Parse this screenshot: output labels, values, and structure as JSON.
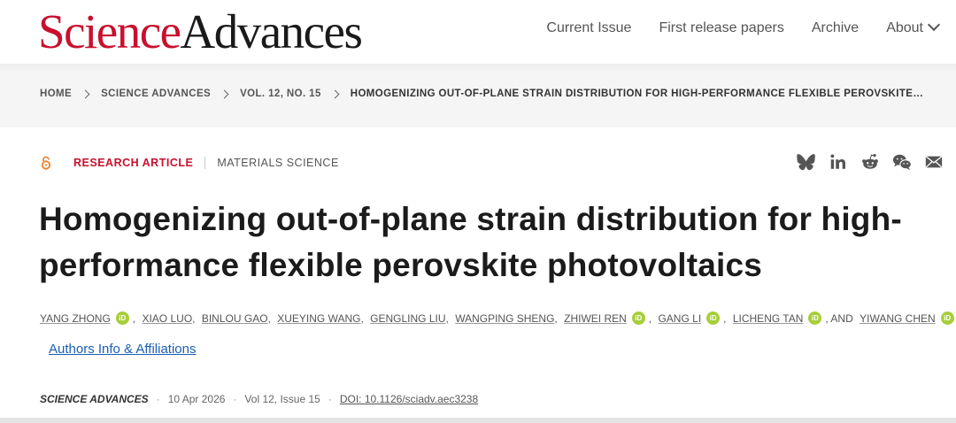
{
  "header": {
    "logo_science": "Science",
    "logo_advances": "Advances",
    "nav": [
      "Current Issue",
      "First release papers",
      "Archive",
      "About"
    ]
  },
  "breadcrumb": [
    "HOME",
    "SCIENCE ADVANCES",
    "VOL. 12, NO. 15",
    "HOMOGENIZING OUT-OF-PLANE STRAIN DISTRIBUTION FOR HIGH-PERFORMANCE FLEXIBLE PEROVSKITE…"
  ],
  "article": {
    "type": "RESEARCH ARTICLE",
    "subject": "MATERIALS SCIENCE",
    "title": "Homogenizing out-of-plane strain distribution for high-performance flexible perovskite photovoltaics",
    "authors": [
      {
        "name": "YANG ZHONG",
        "orcid": true,
        "sep": ","
      },
      {
        "name": "XIAO LUO",
        "orcid": false,
        "sep": ","
      },
      {
        "name": "BINLOU GAO",
        "orcid": false,
        "sep": ","
      },
      {
        "name": "XUEYING WANG",
        "orcid": false,
        "sep": ","
      },
      {
        "name": "GENGLING LIU",
        "orcid": false,
        "sep": ","
      },
      {
        "name": "WANGPING SHENG",
        "orcid": false,
        "sep": ","
      },
      {
        "name": "ZHIWEI REN",
        "orcid": true,
        "sep": ","
      },
      {
        "name": "GANG LI",
        "orcid": true,
        "sep": ","
      },
      {
        "name": "LICHENG TAN",
        "orcid": true,
        "sep": ", AND"
      },
      {
        "name": "YIWANG CHEN",
        "orcid": true,
        "sep": ""
      }
    ],
    "orcid_label": "iD",
    "affiliations_link": "Authors Info & Affiliations",
    "journal": "SCIENCE ADVANCES",
    "date": "10 Apr 2026",
    "volume": "Vol 12, Issue 15",
    "doi": "DOI: 10.1126/sciadv.aec3238"
  },
  "share_icons": [
    "bluesky-icon",
    "linkedin-icon",
    "reddit-icon",
    "wechat-icon",
    "email-icon"
  ],
  "colors": {
    "brand_red": "#c8102e",
    "orcid_green": "#a6ce39",
    "link_blue": "#1a5fb4"
  }
}
